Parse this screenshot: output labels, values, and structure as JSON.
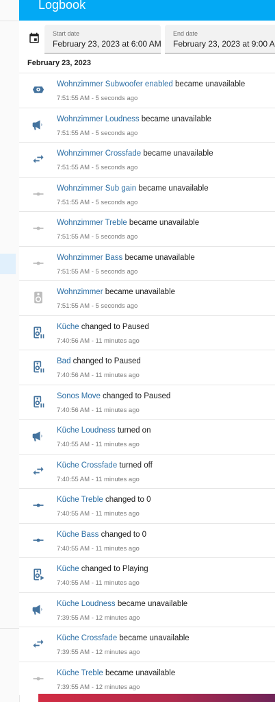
{
  "header": {
    "title": "Logbook"
  },
  "date_range": {
    "start": {
      "label": "Start date",
      "value": "February 23, 2023 at 6:00 AM"
    },
    "end": {
      "label": "End date",
      "value": "February 23, 2023 at 9:00 AM"
    }
  },
  "date_heading": "February 23, 2023",
  "entries": [
    {
      "icon": "subwoofer-icon",
      "entity": "Wohnzimmer Subwoofer enabled",
      "action": " became unavailable",
      "time": "7:51:55 AM - 5 seconds ago"
    },
    {
      "icon": "bullhorn-icon",
      "entity": "Wohnzimmer Loudness",
      "action": " became unavailable",
      "time": "7:51:55 AM - 5 seconds ago"
    },
    {
      "icon": "swap-icon",
      "entity": "Wohnzimmer Crossfade",
      "action": " became unavailable",
      "time": "7:51:55 AM - 5 seconds ago"
    },
    {
      "icon": "slider-icon",
      "entity": "Wohnzimmer Sub gain",
      "action": " became unavailable",
      "time": "7:51:55 AM - 5 seconds ago"
    },
    {
      "icon": "slider-icon",
      "entity": "Wohnzimmer Treble",
      "action": " became unavailable",
      "time": "7:51:55 AM - 5 seconds ago"
    },
    {
      "icon": "slider-icon",
      "entity": "Wohnzimmer Bass",
      "action": " became unavailable",
      "time": "7:51:55 AM - 5 seconds ago"
    },
    {
      "icon": "speaker-icon",
      "entity": "Wohnzimmer",
      "action": " became unavailable",
      "time": "7:51:55 AM - 5 seconds ago"
    },
    {
      "icon": "speaker-pause-icon",
      "entity": "Küche",
      "action": " changed to Paused",
      "time": "7:40:56 AM - 11 minutes ago"
    },
    {
      "icon": "speaker-pause-icon",
      "entity": "Bad",
      "action": " changed to Paused",
      "time": "7:40:56 AM - 11 minutes ago"
    },
    {
      "icon": "speaker-pause-icon",
      "entity": "Sonos Move",
      "action": " changed to Paused",
      "time": "7:40:56 AM - 11 minutes ago"
    },
    {
      "icon": "bullhorn-icon",
      "entity": "Küche Loudness",
      "action": " turned on",
      "time": "7:40:55 AM - 11 minutes ago"
    },
    {
      "icon": "swap-icon",
      "entity": "Küche Crossfade",
      "action": " turned off",
      "time": "7:40:55 AM - 11 minutes ago"
    },
    {
      "icon": "slider-icon",
      "entity": "Küche Treble",
      "action": " changed to 0",
      "time": "7:40:55 AM - 11 minutes ago"
    },
    {
      "icon": "slider-icon",
      "entity": "Küche Bass",
      "action": " changed to 0",
      "time": "7:40:55 AM - 11 minutes ago"
    },
    {
      "icon": "speaker-play-icon",
      "entity": "Küche",
      "action": " changed to Playing",
      "time": "7:40:55 AM - 11 minutes ago"
    },
    {
      "icon": "bullhorn-icon",
      "entity": "Küche Loudness",
      "action": " became unavailable",
      "time": "7:39:55 AM - 12 minutes ago"
    },
    {
      "icon": "swap-icon",
      "entity": "Küche Crossfade",
      "action": " became unavailable",
      "time": "7:39:55 AM - 12 minutes ago"
    },
    {
      "icon": "slider-icon",
      "entity": "Küche Treble",
      "action": " became unavailable",
      "time": "7:39:55 AM - 12 minutes ago"
    }
  ],
  "colors": {
    "header": "#03a9f4",
    "entity_link": "#2c6fa5",
    "icon_active": "#44739e",
    "icon_unavailable": "#bdbdbd"
  }
}
